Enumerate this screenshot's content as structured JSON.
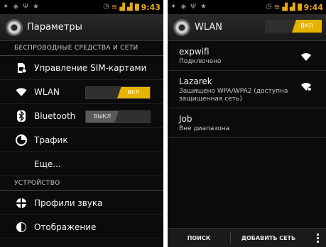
{
  "status_bar_left": {
    "time": "9:43"
  },
  "status_bar_right": {
    "time": "9:44"
  },
  "settings": {
    "title": "Параметры",
    "sections": {
      "wireless": "БЕСПРОВОДНЫЕ СРЕДСТВА И СЕТИ",
      "device": "УСТРОЙСТВО"
    },
    "items": {
      "sim": "Управление SIM-картами",
      "wlan": "WLAN",
      "wlan_toggle": "ВКЛ",
      "bluetooth": "Bluetooth",
      "bluetooth_toggle": "ВЫКЛ",
      "traffic": "Трафик",
      "more": "Еще...",
      "sound": "Профили звука",
      "display": "Отображение"
    }
  },
  "wlan": {
    "title": "WLAN",
    "toggle": "ВКЛ",
    "networks": [
      {
        "name": "expwifi",
        "status": "Подключено"
      },
      {
        "name": "Lazarek",
        "status": "Защищено WPA/WPA2 (доступна защищенная сеть)"
      },
      {
        "name": "Job",
        "status": "Вне диапазона"
      }
    ],
    "buttons": {
      "search": "ПОИСК",
      "add_network": "ДОБАВИТЬ СЕТЬ"
    }
  },
  "colors": {
    "accent": "#e6b400",
    "background": "#0b0b0b"
  },
  "icons": [
    "gear-icon",
    "sim-icon",
    "wifi-icon",
    "bluetooth-icon",
    "traffic-icon",
    "sound-icon",
    "display-icon",
    "overflow-menu-icon"
  ]
}
